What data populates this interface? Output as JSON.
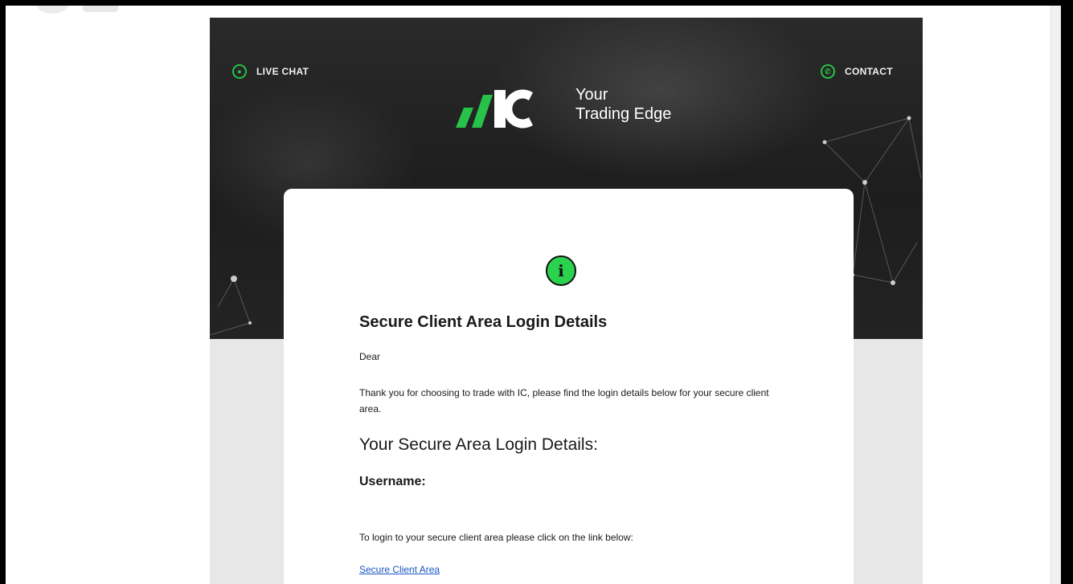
{
  "header": {
    "live_chat_label": "LIVE CHAT",
    "contact_label": "CONTACT"
  },
  "logo": {
    "wordmark": "IC",
    "tagline_line1": "Your",
    "tagline_line2": "Trading Edge"
  },
  "content": {
    "title": "Secure Client Area Login Details",
    "greeting": "Dear",
    "intro": "Thank you for choosing to trade with IC, please find the login details below for your secure client area.",
    "section_heading": "Your Secure Area Login Details:",
    "username_label": "Username:",
    "login_instruction": "To login to your secure client area please click on the link below:",
    "link_label": "Secure Client Area"
  },
  "colors": {
    "brand_green": "#26c24a",
    "link_blue": "#1a55c4",
    "banner_dark": "#1d1d1d"
  },
  "icons": [
    "chat-icon",
    "phone-icon",
    "info-icon"
  ]
}
